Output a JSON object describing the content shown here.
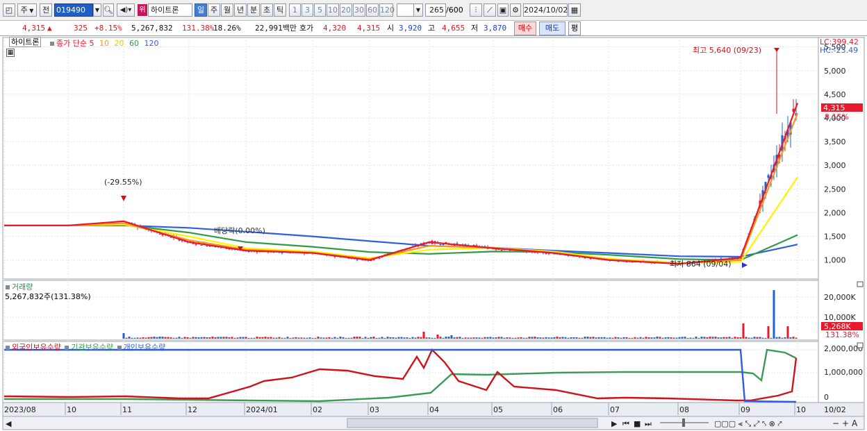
{
  "toolbar": {
    "market": "주",
    "prev": "전",
    "code": "019490",
    "badge": "위",
    "name": "하이트론",
    "periods": [
      "일",
      "주",
      "월",
      "년",
      "분",
      "초",
      "틱"
    ],
    "intervals": [
      "1",
      "3",
      "5",
      "10",
      "20",
      "30",
      "60",
      "120"
    ],
    "count": "265",
    "count_total": "/600",
    "date": "2024/10/02"
  },
  "quote": {
    "price": "4,315",
    "arrow": "▲",
    "change": "325",
    "change_pct": "+8.15%",
    "volume": "5,267,832",
    "volume_ratio": "131.38%",
    "turnover": "18.26%",
    "amount": "22,991백만",
    "hoga_label": "호가",
    "ask": "4,320",
    "bid": "4,315",
    "open_label": "시",
    "open": "3,920",
    "high_label": "고",
    "high": "4,655",
    "low_label": "저",
    "low": "3,870",
    "buy_label": "매수",
    "sell_label": "매도",
    "pyeong_label": "평"
  },
  "price_panel": {
    "stock_label": "하이트론",
    "ma_title": "종가 단순",
    "ma_periods": [
      "5",
      "10",
      "20",
      "60",
      "120"
    ],
    "lc": "LC:399.42",
    "hc": "HC:-23.49",
    "max_label": "최고 5,640 (09/23)",
    "min_label": "최저 864 (09/04)",
    "drop_label": "(-29.55%)",
    "rights_label": "배당락(0.00%)",
    "price_ticks": [
      "5,500",
      "5,000",
      "4,500",
      "4,000",
      "3,500",
      "3,000",
      "2,500",
      "2,000",
      "1,500",
      "1,000"
    ],
    "current_price": "4,315",
    "current_pct": "8.15%"
  },
  "volume_panel": {
    "title": "거래량",
    "value_label": "5,267,832주(131.38%)",
    "ticks": [
      "20,000K",
      "10,000K"
    ],
    "current": "5,268K",
    "current_pct": "131.38%"
  },
  "holding_panel": {
    "legend": [
      "외국인보유수량",
      "기관보유수량",
      "개인보유수량"
    ],
    "ticks": [
      "2,000,000",
      "1,000,000",
      "0"
    ]
  },
  "x_axis": {
    "labels": [
      "2023/08",
      "10",
      "11",
      "12",
      "2024/01",
      "02",
      "03",
      "04",
      "05",
      "06",
      "07",
      "08",
      "09",
      "10",
      "10/02"
    ]
  },
  "colors": {
    "ma5": "#e8192c",
    "ma10": "#f29a1f",
    "ma20": "#fff200",
    "ma60": "#2e9b47",
    "ma120": "#2f5fe0",
    "up_candle": "#e8192c",
    "down_candle": "#1e63d6",
    "foreign": "#d0111b",
    "institution": "#3a9a56",
    "individual": "#2c5ce0"
  },
  "chart_data": {
    "type": "line",
    "title": "",
    "xlabel": "",
    "ylabel": "",
    "x": [
      "2023/08",
      "2023/10",
      "2023/11",
      "2023/12",
      "2024/01",
      "2024/02",
      "2024/03",
      "2024/04",
      "2024/05",
      "2024/06",
      "2024/07",
      "2024/08",
      "2024/09",
      "2024/10"
    ],
    "series": [
      {
        "name": "5",
        "values": [
          1730,
          1730,
          1820,
          1380,
          1200,
          1150,
          1000,
          1380,
          1250,
          1150,
          1000,
          920,
          1050,
          4315
        ]
      },
      {
        "name": "10",
        "values": [
          1730,
          1730,
          1780,
          1420,
          1220,
          1160,
          1020,
          1300,
          1260,
          1160,
          1010,
          930,
          1000,
          4100
        ]
      },
      {
        "name": "20",
        "values": [
          1730,
          1730,
          1750,
          1500,
          1250,
          1180,
          1040,
          1220,
          1260,
          1180,
          1030,
          940,
          960,
          2750
        ]
      },
      {
        "name": "60",
        "values": [
          1730,
          1730,
          1740,
          1580,
          1380,
          1280,
          1170,
          1130,
          1180,
          1170,
          1110,
          1020,
          1000,
          1530
        ]
      },
      {
        "name": "120",
        "values": [
          1730,
          1730,
          1730,
          1680,
          1600,
          1500,
          1400,
          1300,
          1260,
          1200,
          1150,
          1080,
          1070,
          1330
        ]
      }
    ],
    "ylim": [
      600,
      5700
    ],
    "max": {
      "value": 5640,
      "date": "09/23"
    },
    "min": {
      "value": 864,
      "date": "09/04"
    }
  }
}
